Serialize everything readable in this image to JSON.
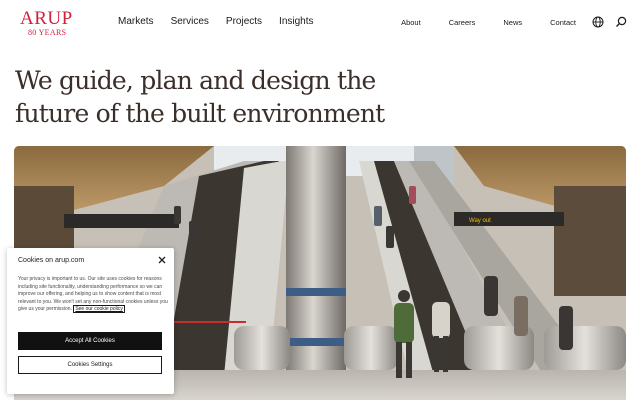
{
  "brand": {
    "name": "ARUP",
    "tagline": "80 YEARS",
    "color": "#d21f3c"
  },
  "primary_nav": [
    "Markets",
    "Services",
    "Projects",
    "Insights"
  ],
  "secondary_nav": [
    "About",
    "Careers",
    "News",
    "Contact"
  ],
  "icons": {
    "language": "globe-icon",
    "search": "search-icon",
    "close": "close-icon"
  },
  "hero": {
    "line1": "We guide, plan and design the",
    "line2": "future of the built environment",
    "image_sign": "Way out"
  },
  "cookie": {
    "title": "Cookies on arup.com",
    "body": "Your privacy is important to us. Our site uses cookies for reasons including site functionality, understanding performance so we can improve our offering, and helping us to show content that is most relevant to you. We won't set any non-functional cookies unless you give us your permission.",
    "policy_link": "See our cookie policy",
    "accept_label": "Accept All Cookies",
    "settings_label": "Cookies Settings"
  }
}
